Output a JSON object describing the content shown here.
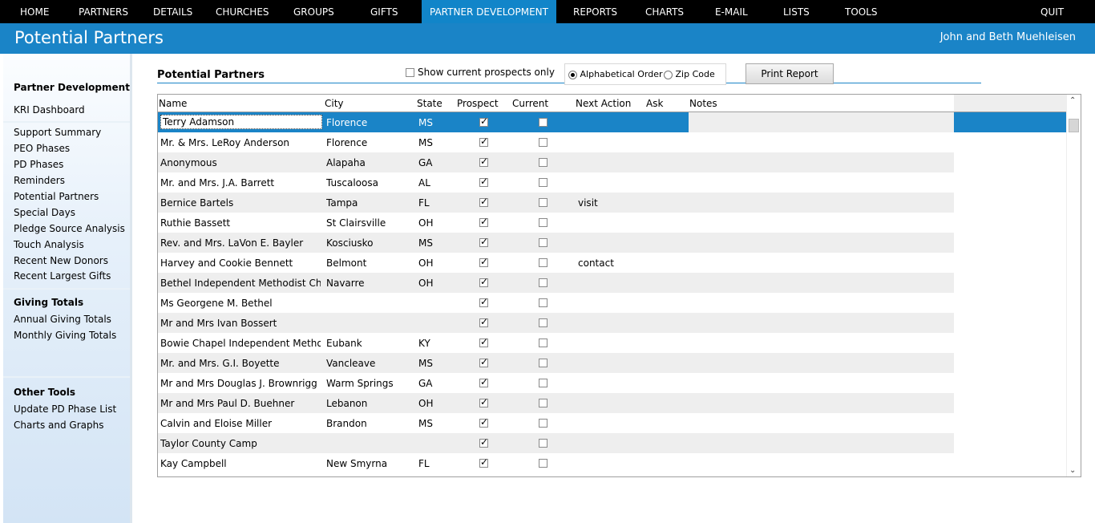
{
  "nav": {
    "items": [
      "HOME",
      "PARTNERS",
      "DETAILS",
      "CHURCHES",
      "GROUPS",
      "GIFTS",
      "PARTNER DEVELOPMENT",
      "REPORTS",
      "CHARTS",
      "E-MAIL",
      "LISTS",
      "TOOLS",
      "QUIT"
    ],
    "active": "PARTNER DEVELOPMENT"
  },
  "header": {
    "title": "Potential Partners",
    "user": "John and Beth Muehleisen"
  },
  "sidebar": {
    "section1": "Partner Development",
    "kri": "KRI Dashboard",
    "items": [
      "Support Summary",
      "PEO Phases",
      "PD Phases",
      "Reminders",
      "Potential Partners",
      "Special Days",
      "Pledge Source Analysis",
      "Touch Analysis",
      "Recent New Donors",
      "Recent Largest Gifts"
    ],
    "section2": "Giving Totals",
    "giving": [
      "Annual Giving Totals",
      "Monthly Giving Totals"
    ],
    "section3": "Other Tools",
    "tools": [
      "Update PD Phase List",
      "Charts and Graphs"
    ]
  },
  "main": {
    "section_title": "Potential Partners",
    "show_current_label": "Show current prospects only",
    "show_current_checked": false,
    "order_options": [
      "Alphabetical Order",
      "Zip Code"
    ],
    "order_selected": "Alphabetical Order",
    "print_label": "Print Report"
  },
  "grid": {
    "columns": [
      "Name",
      "City",
      "State",
      "Prospect",
      "Current",
      "Next Action",
      "Ask",
      "Notes"
    ],
    "rows": [
      {
        "name": "Terry Adamson",
        "city": "Florence",
        "state": "MS",
        "prospect": true,
        "current": false,
        "next": ""
      },
      {
        "name": "Mr. & Mrs. LeRoy Anderson",
        "city": "Florence",
        "state": "MS",
        "prospect": true,
        "current": false,
        "next": ""
      },
      {
        "name": "Anonymous",
        "city": "Alapaha",
        "state": "GA",
        "prospect": true,
        "current": false,
        "next": ""
      },
      {
        "name": "Mr. and Mrs. J.A. Barrett",
        "city": "Tuscaloosa",
        "state": "AL",
        "prospect": true,
        "current": false,
        "next": ""
      },
      {
        "name": "Bernice Bartels",
        "city": "Tampa",
        "state": "FL",
        "prospect": true,
        "current": false,
        "next": "visit"
      },
      {
        "name": "Ruthie Bassett",
        "city": "St Clairsville",
        "state": "OH",
        "prospect": true,
        "current": false,
        "next": ""
      },
      {
        "name": "Rev. and Mrs. LaVon E. Bayler",
        "city": "Kosciusko",
        "state": "MS",
        "prospect": true,
        "current": false,
        "next": ""
      },
      {
        "name": "Harvey and Cookie Bennett",
        "city": "Belmont",
        "state": "OH",
        "prospect": true,
        "current": false,
        "next": "contact"
      },
      {
        "name": "Bethel Independent Methodist Church",
        "city": "Navarre",
        "state": "OH",
        "prospect": true,
        "current": false,
        "next": ""
      },
      {
        "name": "Ms Georgene M. Bethel",
        "city": "",
        "state": "",
        "prospect": true,
        "current": false,
        "next": ""
      },
      {
        "name": "Mr and Mrs Ivan Bossert",
        "city": "",
        "state": "",
        "prospect": true,
        "current": false,
        "next": ""
      },
      {
        "name": "Bowie Chapel Independent Methodist",
        "city": "Eubank",
        "state": "KY",
        "prospect": true,
        "current": false,
        "next": ""
      },
      {
        "name": "Mr. and Mrs. G.I. Boyette",
        "city": "Vancleave",
        "state": "MS",
        "prospect": true,
        "current": false,
        "next": ""
      },
      {
        "name": "Mr and Mrs Douglas J. Brownrigg",
        "city": "Warm Springs",
        "state": "GA",
        "prospect": true,
        "current": false,
        "next": ""
      },
      {
        "name": "Mr and Mrs Paul D. Buehner",
        "city": "Lebanon",
        "state": "OH",
        "prospect": true,
        "current": false,
        "next": ""
      },
      {
        "name": "Calvin and Eloise Miller",
        "city": "Brandon",
        "state": "MS",
        "prospect": true,
        "current": false,
        "next": ""
      },
      {
        "name": "Taylor County Camp",
        "city": "",
        "state": "",
        "prospect": true,
        "current": false,
        "next": ""
      },
      {
        "name": "Kay Campbell",
        "city": "New Smyrna",
        "state": "FL",
        "prospect": true,
        "current": false,
        "next": ""
      }
    ],
    "selected_index": 0
  },
  "icons": {
    "scroll_up": "chevron-up-icon",
    "scroll_down": "chevron-down-icon"
  },
  "colors": {
    "accent": "#1a84c7",
    "nav_bg": "#000000",
    "row_alt": "#eeeeee"
  }
}
